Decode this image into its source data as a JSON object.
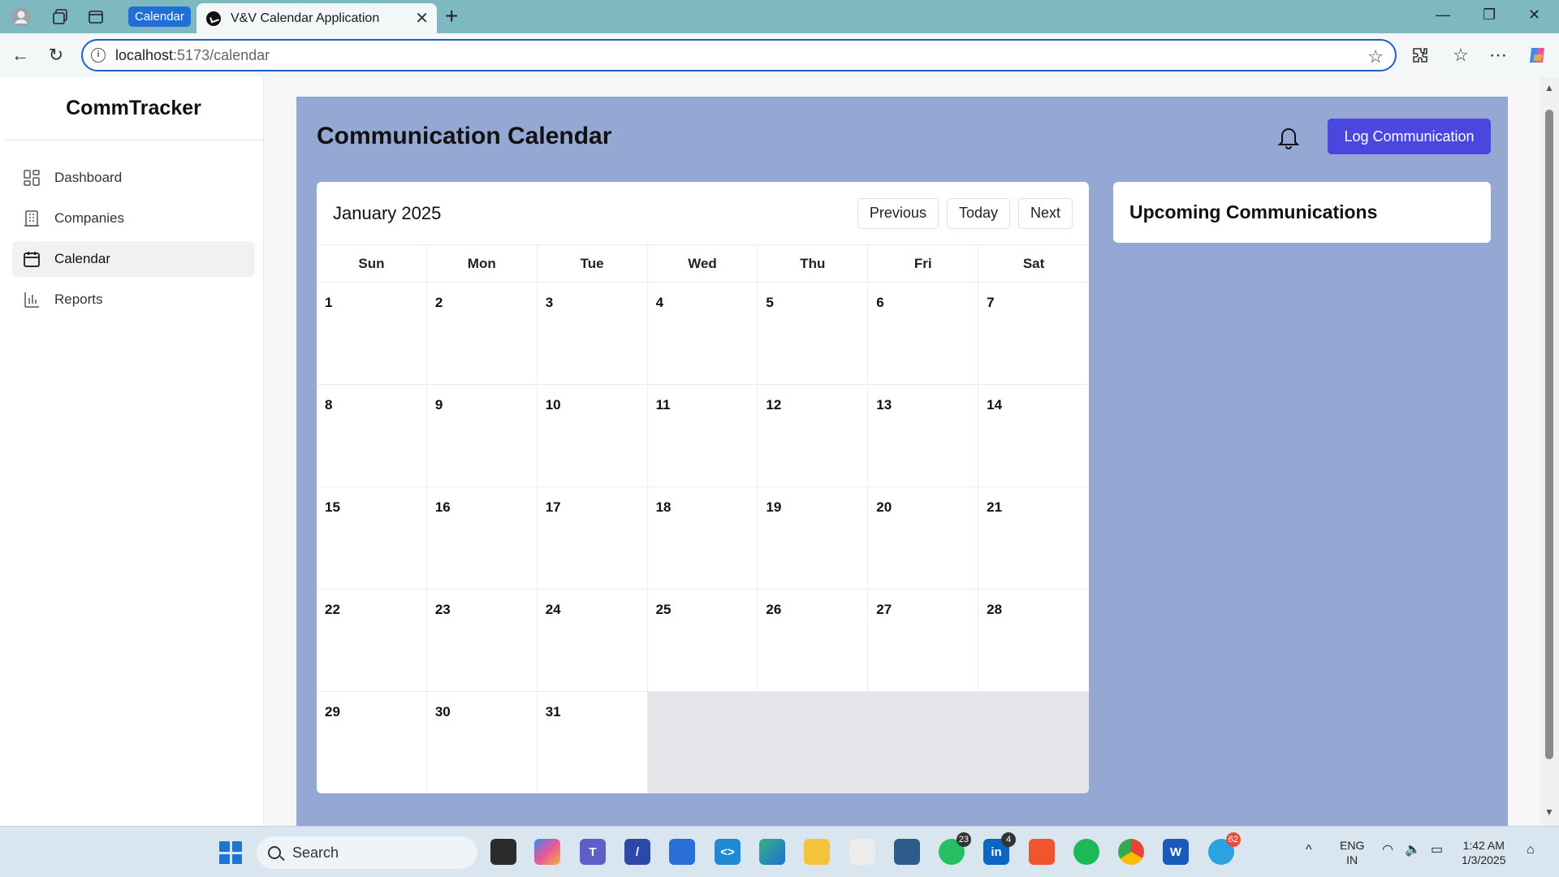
{
  "browser": {
    "tab_group_label": "Calendar",
    "active_tab_title": "V&V Calendar Application",
    "url_host": "localhost",
    "url_path": ":5173/calendar"
  },
  "sidebar": {
    "brand": "CommTracker",
    "items": [
      {
        "label": "Dashboard",
        "icon": "dashboard-icon",
        "active": false
      },
      {
        "label": "Companies",
        "icon": "building-icon",
        "active": false
      },
      {
        "label": "Calendar",
        "icon": "calendar-icon",
        "active": true
      },
      {
        "label": "Reports",
        "icon": "bar-chart-icon",
        "active": false
      }
    ]
  },
  "main": {
    "title": "Communication Calendar",
    "log_button": "Log Communication",
    "accent_color": "#4a47e0",
    "background_color": "#95a7d3"
  },
  "calendar": {
    "month_label": "January 2025",
    "prev_label": "Previous",
    "today_label": "Today",
    "next_label": "Next",
    "weekdays": [
      "Sun",
      "Mon",
      "Tue",
      "Wed",
      "Thu",
      "Fri",
      "Sat"
    ],
    "days": [
      "1",
      "2",
      "3",
      "4",
      "5",
      "6",
      "7",
      "8",
      "9",
      "10",
      "11",
      "12",
      "13",
      "14",
      "15",
      "16",
      "17",
      "18",
      "19",
      "20",
      "21",
      "22",
      "23",
      "24",
      "25",
      "26",
      "27",
      "28",
      "29",
      "30",
      "31"
    ]
  },
  "upcoming": {
    "title": "Upcoming Communications"
  },
  "taskbar": {
    "search_label": "Search",
    "whatsapp_badge": "23",
    "linkedin_badge": "4",
    "telegram_badge": "62",
    "lang_line1": "ENG",
    "lang_line2": "IN",
    "time": "1:42 AM",
    "date": "1/3/2025"
  }
}
